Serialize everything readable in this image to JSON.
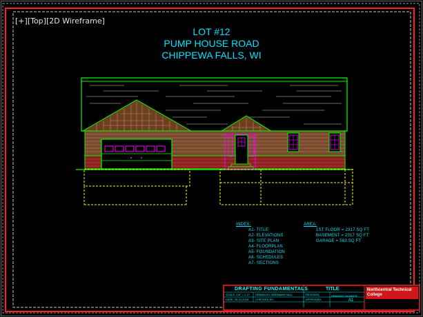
{
  "viewport_controls": {
    "plus": "[+]",
    "view": "[Top]",
    "style": "[2D Wireframe]"
  },
  "title_block_header": {
    "line1": "LOT #12",
    "line2": "PUMP HOUSE ROAD",
    "line3": "CHIPPEWA FALLS, WI"
  },
  "index": {
    "header": "INDEX:",
    "items": [
      "A1- TITLE",
      "A2- ELEVATIONS",
      "A3- SITE PLAN",
      "A4- FLOORPLAN",
      "A5- FOUNDATION",
      "A6- SCHEDULES",
      "A7- SECTIONS"
    ]
  },
  "area": {
    "header": "AREA:",
    "items": [
      "1ST FLOOR = 2317 SQ FT",
      "BASEMENT = 2317 SQ FT",
      "GARAGE = 563 SQ FT"
    ]
  },
  "title_block": {
    "course": "DRAFTING FUNDAMENTALS",
    "sheet_title": "TITLE",
    "scale": "SCALE: 1/8\" = 1'-0\"",
    "date": "DATE: 05-10-2018",
    "drawn_by": "DRAWN BY: BRENNAN HALL",
    "checked_by": "CHECKED BY:",
    "revision": "REVISION:",
    "approved": "APPROVED:",
    "drawing_number_label": "DRAWING NUMBER:",
    "drawing_number": "A1",
    "college": "Northcentral Technical College"
  },
  "colors": {
    "border_red": "#ff2020",
    "frame_white": "#d0d0d0",
    "cyan": "#00e5ff",
    "green": "#00ff00",
    "yellow": "#ffff00",
    "magenta": "#ff00ff",
    "brick": "#b03030",
    "siding": "#c08a5a"
  }
}
